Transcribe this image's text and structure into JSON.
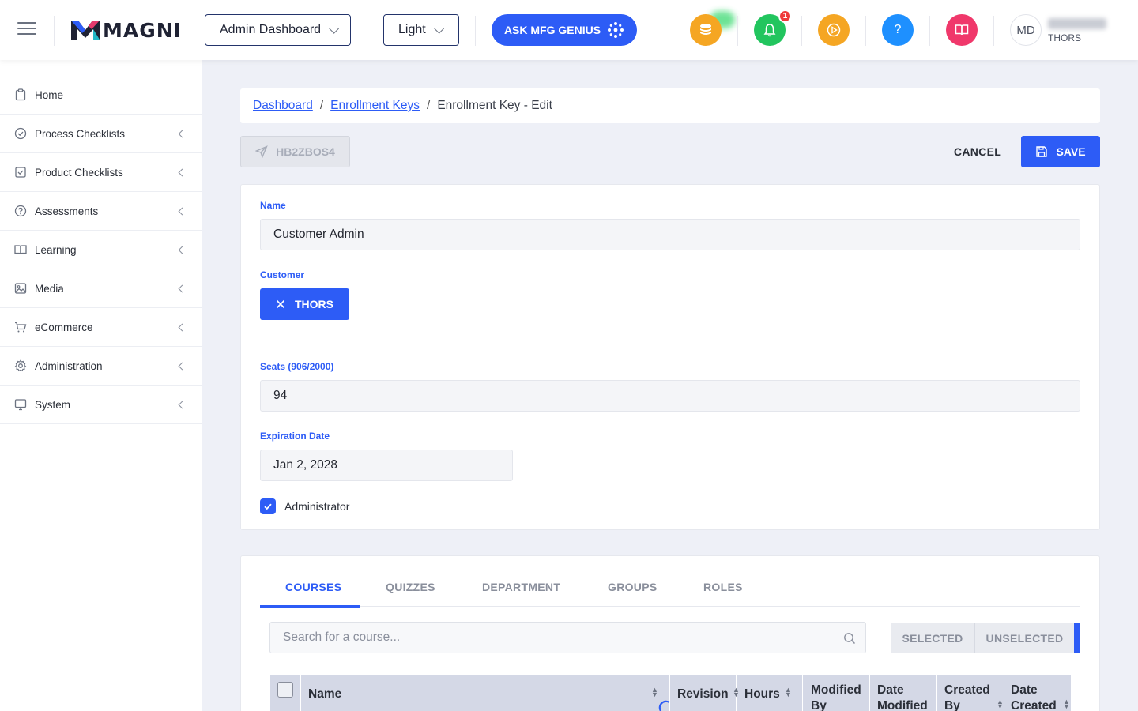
{
  "header": {
    "logo_text": "MAGNI",
    "dashboard_select": "Admin Dashboard",
    "theme_select": "Light",
    "genius_button": "ASK MFG GENIUS",
    "notification_count": "1",
    "help_label": "?",
    "user_initials": "MD",
    "user_org": "THORS"
  },
  "sidebar": {
    "items": [
      {
        "label": "Home",
        "icon": "clipboard-icon"
      },
      {
        "label": "Process Checklists",
        "icon": "check-circle-icon"
      },
      {
        "label": "Product Checklists",
        "icon": "check-square-icon"
      },
      {
        "label": "Assessments",
        "icon": "question-circle-icon"
      },
      {
        "label": "Learning",
        "icon": "book-icon"
      },
      {
        "label": "Media",
        "icon": "image-icon"
      },
      {
        "label": "eCommerce",
        "icon": "cart-icon"
      },
      {
        "label": "Administration",
        "icon": "gear-icon"
      },
      {
        "label": "System",
        "icon": "monitor-icon"
      }
    ]
  },
  "breadcrumb": {
    "items": [
      "Dashboard",
      "Enrollment Keys"
    ],
    "separator": "/",
    "current": "Enrollment Key - Edit"
  },
  "actions": {
    "key_code": "HB2ZBOS4",
    "cancel": "CANCEL",
    "save": "SAVE"
  },
  "form": {
    "name_label": "Name",
    "name_value": "Customer Admin",
    "customer_label": "Customer",
    "customer_chip": "THORS",
    "seats_label": "Seats (906/2000)",
    "seats_value": "94",
    "expiration_label": "Expiration Date",
    "expiration_value": "Jan 2, 2028",
    "administrator_label": "Administrator",
    "administrator_checked": true
  },
  "tabs": [
    "COURSES",
    "QUIZZES",
    "DEPARTMENT",
    "GROUPS",
    "ROLES"
  ],
  "active_tab": "COURSES",
  "courses": {
    "search_placeholder": "Search for a course...",
    "filter_selected": "SELECTED",
    "filter_unselected": "UNSELECTED",
    "columns": [
      "Name",
      "Revision",
      "Hours",
      "Modified By",
      "Date Modified",
      "Created By",
      "Date Created"
    ]
  },
  "colors": {
    "accent": "#2d5cf6",
    "coins": "#f5a623",
    "bell": "#22c55e",
    "play": "#f5a623",
    "help": "#1e90ff",
    "book": "#f0386b"
  }
}
